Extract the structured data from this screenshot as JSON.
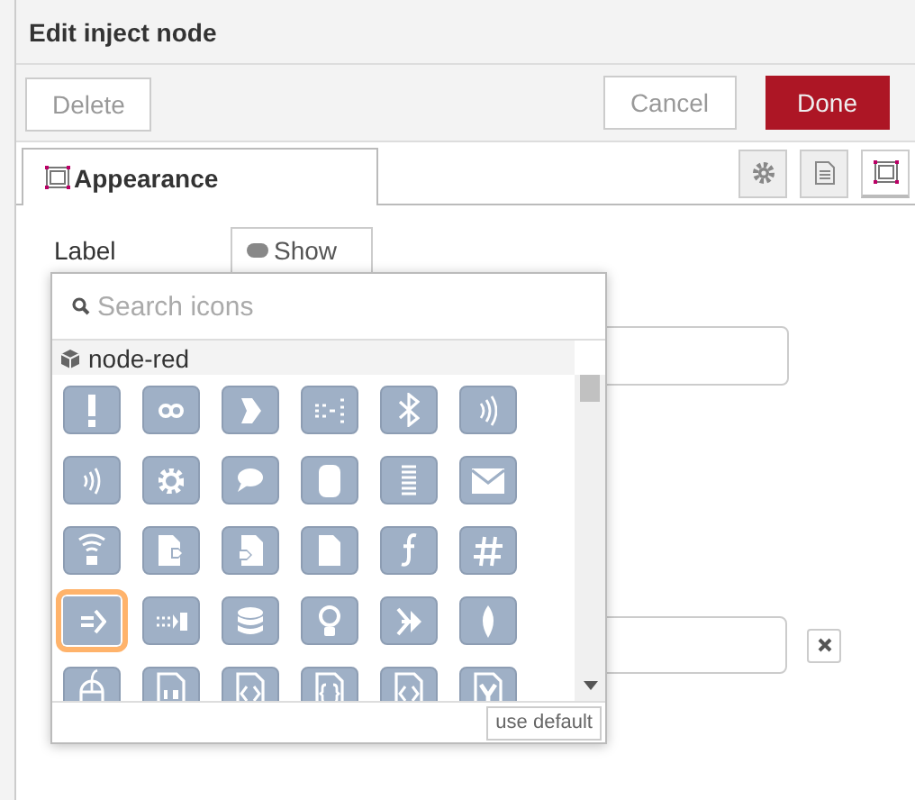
{
  "window": {
    "title": "Edit inject node"
  },
  "buttons": [
    {
      "label": "Delete",
      "kind": "plain"
    },
    {
      "label": "Cancel",
      "kind": "plain"
    },
    {
      "label": "Done",
      "kind": "primary"
    }
  ],
  "tabs": [
    {
      "label": "Appearance",
      "selected": true
    }
  ],
  "side_tabs": [
    {
      "selected": false
    },
    {
      "selected": false
    },
    {
      "selected": true
    }
  ],
  "form": {
    "label": "Label",
    "toggle": "Show"
  },
  "icon_picker": {
    "search": {
      "placeholder": "Search icons"
    },
    "group": "node-red",
    "default_button": "use default",
    "icons": [
      {
        "selected": false
      },
      {
        "selected": false
      },
      {
        "selected": false
      },
      {
        "selected": false
      },
      {
        "selected": false
      },
      {
        "selected": false
      },
      {
        "selected": false
      },
      {
        "selected": false
      },
      {
        "selected": false
      },
      {
        "selected": false
      },
      {
        "selected": false
      },
      {
        "selected": false
      },
      {
        "selected": false
      },
      {
        "selected": false
      },
      {
        "selected": false
      },
      {
        "selected": false
      },
      {
        "selected": false
      },
      {
        "selected": false
      },
      {
        "selected": true
      },
      {
        "selected": false
      },
      {
        "selected": false
      },
      {
        "selected": false
      },
      {
        "selected": false
      },
      {
        "selected": false
      },
      {
        "selected": false
      },
      {
        "selected": false
      },
      {
        "selected": false
      },
      {
        "selected": false
      },
      {
        "selected": false
      },
      {
        "selected": false
      }
    ]
  }
}
